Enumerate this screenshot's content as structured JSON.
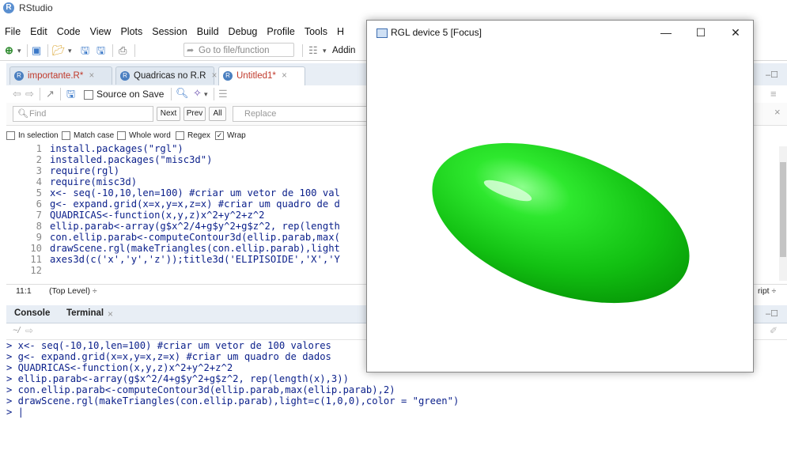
{
  "app": {
    "title": "RStudio"
  },
  "menu": [
    "File",
    "Edit",
    "Code",
    "View",
    "Plots",
    "Session",
    "Build",
    "Debug",
    "Profile",
    "Tools",
    "H"
  ],
  "toolbar": {
    "goto_placeholder": "Go to file/function",
    "addins_label": "Addin"
  },
  "editor": {
    "tabs": [
      {
        "label": "importante.R*",
        "modified": true,
        "active": false
      },
      {
        "label": "Quadricas no R.R",
        "modified": false,
        "active": false
      },
      {
        "label": "Untitled1*",
        "modified": true,
        "active": true
      }
    ],
    "source_on_save": "Source on Save",
    "find": {
      "find_placeholder": "Find",
      "next": "Next",
      "prev": "Prev",
      "all": "All",
      "replace_placeholder": "Replace"
    },
    "options": {
      "in_selection": "In selection",
      "match_case": "Match case",
      "whole_word": "Whole word",
      "regex": "Regex",
      "wrap": "Wrap"
    },
    "code_lines": [
      {
        "n": "1",
        "text": "install.packages(\"rgl\")"
      },
      {
        "n": "2",
        "text": "installed.packages(\"misc3d\")"
      },
      {
        "n": "3",
        "text": "require(rgl)"
      },
      {
        "n": "4",
        "text": "require(misc3d)"
      },
      {
        "n": "5",
        "text": "x<- seq(-10,10,len=100) #criar um vetor de 100 val"
      },
      {
        "n": "6",
        "text": "g<- expand.grid(x=x,y=x,z=x) #criar um quadro de d"
      },
      {
        "n": "7",
        "text": "QUADRICAS<-function(x,y,z)x^2+y^2+z^2"
      },
      {
        "n": "8",
        "text": "ellip.parab<-array(g$x^2/4+g$y^2+g$z^2, rep(length"
      },
      {
        "n": "9",
        "text": "con.ellip.parab<-computeContour3d(ellip.parab,max("
      },
      {
        "n": "10",
        "text": "drawScene.rgl(makeTriangles(con.ellip.parab),light"
      },
      {
        "n": "11",
        "text": "axes3d(c('x','y','z'));title3d('ELIPISOIDE','X','Y"
      },
      {
        "n": "12",
        "text": ""
      }
    ],
    "status": {
      "position": "11:1",
      "scope": "(Top Level) ÷",
      "right": "ript ÷"
    }
  },
  "console": {
    "tabs": [
      "Console",
      "Terminal"
    ],
    "path": "~/",
    "lines": [
      "> x<- seq(-10,10,len=100) #criar um vetor de 100 valores",
      "> g<- expand.grid(x=x,y=x,z=x) #criar um quadro de dados",
      "> QUADRICAS<-function(x,y,z)x^2+y^2+z^2",
      "> ellip.parab<-array(g$x^2/4+g$y^2+g$z^2, rep(length(x),3))",
      "> con.ellip.parab<-computeContour3d(ellip.parab,max(ellip.parab),2)",
      "> drawScene.rgl(makeTriangles(con.ellip.parab),light=c(1,0,0),color = \"green\")",
      "> |"
    ]
  },
  "rgl": {
    "title": "RGL device 5 [Focus]",
    "minimize": "—",
    "maximize": "☐",
    "close": "✕",
    "shape_color": "#22cc22"
  },
  "colors": {
    "accent": "#3a78c8",
    "code": "#0a1f8a",
    "string": "#0a7a3a"
  }
}
